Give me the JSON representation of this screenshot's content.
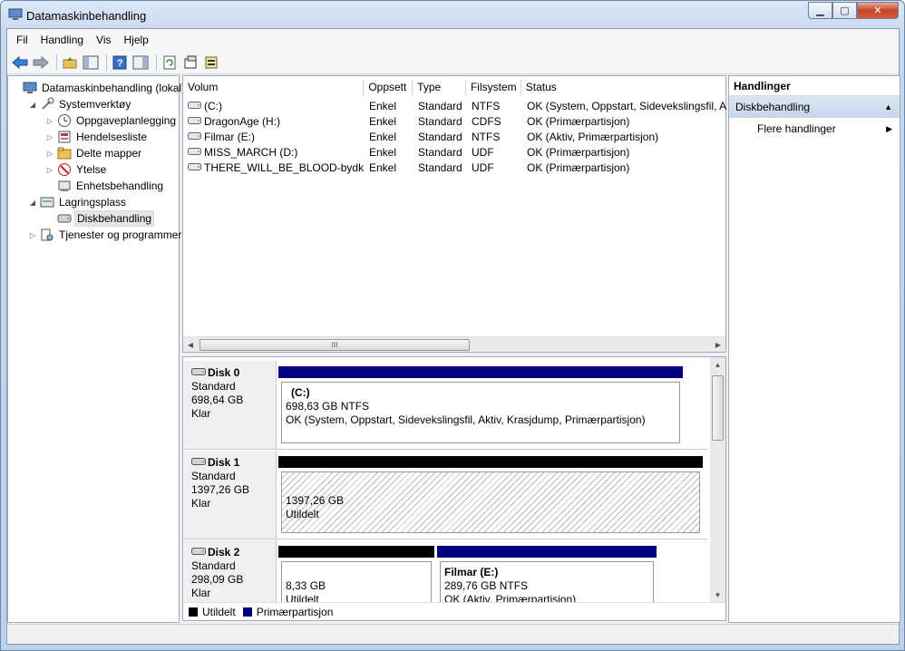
{
  "window": {
    "title": "Datamaskinbehandling",
    "buttons": {
      "minimize": "▁",
      "maximize": "▢",
      "close": "✕"
    }
  },
  "menubar": {
    "items": [
      "Fil",
      "Handling",
      "Vis",
      "Hjelp"
    ]
  },
  "toolbar": {
    "icons": [
      "back-arrow-icon",
      "forward-arrow-icon",
      "up-folder-icon",
      "show-hide-tree-icon",
      "help-icon",
      "show-hide-action-icon",
      "refresh-icon",
      "properties-icon",
      "export-icon"
    ]
  },
  "tree": {
    "items": [
      {
        "label": "Datamaskinbehandling (lokal)",
        "level": 0,
        "expander": "",
        "icon": "computer-icon"
      },
      {
        "label": "Systemverktøy",
        "level": 1,
        "expander": "◢",
        "icon": "tools-icon"
      },
      {
        "label": "Oppgaveplanlegging",
        "level": 2,
        "expander": "▷",
        "icon": "clock-icon"
      },
      {
        "label": "Hendelsesliste",
        "level": 2,
        "expander": "▷",
        "icon": "event-viewer-icon"
      },
      {
        "label": "Delte mapper",
        "level": 2,
        "expander": "▷",
        "icon": "shared-folder-icon"
      },
      {
        "label": "Ytelse",
        "level": 2,
        "expander": "▷",
        "icon": "performance-icon"
      },
      {
        "label": "Enhetsbehandling",
        "level": 2,
        "expander": "",
        "icon": "device-manager-icon"
      },
      {
        "label": "Lagringsplass",
        "level": 1,
        "expander": "◢",
        "icon": "storage-icon"
      },
      {
        "label": "Diskbehandling",
        "level": 2,
        "expander": "",
        "icon": "disk-management-icon",
        "selected": true
      },
      {
        "label": "Tjenester og programmer",
        "level": 1,
        "expander": "▷",
        "icon": "services-icon"
      }
    ]
  },
  "volume_list": {
    "columns": [
      "Volum",
      "Oppsett",
      "Type",
      "Filsystem",
      "Status"
    ],
    "rows": [
      {
        "volume": " (C:)",
        "layout": "Enkel",
        "type": "Standard",
        "fs": "NTFS",
        "status": "OK (System, Oppstart, Sidevekslingsfil, A"
      },
      {
        "volume": "DragonAge (H:)",
        "layout": "Enkel",
        "type": "Standard",
        "fs": "CDFS",
        "status": "OK (Primærpartisjon)"
      },
      {
        "volume": "Filmar (E:)",
        "layout": "Enkel",
        "type": "Standard",
        "fs": "NTFS",
        "status": "OK (Aktiv, Primærpartisjon)"
      },
      {
        "volume": "MISS_MARCH (D:)",
        "layout": "Enkel",
        "type": "Standard",
        "fs": "UDF",
        "status": "OK (Primærpartisjon)"
      },
      {
        "volume": "THERE_WILL_BE_BLOOD-bydk (J:)",
        "layout": "Enkel",
        "type": "Standard",
        "fs": "UDF",
        "status": "OK (Primærpartisjon)"
      }
    ],
    "scroll_thumb": "III"
  },
  "disks": [
    {
      "name": "Disk 0",
      "type": "Standard",
      "size": "698,64 GB",
      "state": "Klar",
      "partitions": [
        {
          "title": "(C:)",
          "size": "698,63 GB NTFS",
          "status": "OK (System, Oppstart, Sidevekslingsfil, Aktiv, Krasjdump, Primærpartisjon)",
          "kind": "primary"
        }
      ]
    },
    {
      "name": "Disk 1",
      "type": "Standard",
      "size": "1397,26 GB",
      "state": "Klar",
      "partitions": [
        {
          "title": "",
          "size": "1397,26 GB",
          "status": "Utildelt",
          "kind": "unallocated"
        }
      ]
    },
    {
      "name": "Disk 2",
      "type": "Standard",
      "size": "298,09 GB",
      "state": "Klar",
      "partitions": [
        {
          "title": "",
          "size": "8,33 GB",
          "status": "Utildelt",
          "kind": "unallocated"
        },
        {
          "title": "Filmar  (E:)",
          "size": "289,76 GB NTFS",
          "status": "OK (Aktiv, Primærpartisjon)",
          "kind": "primary"
        }
      ]
    }
  ],
  "legend": {
    "unallocated": "Utildelt",
    "primary": "Primærpartisjon",
    "colors": {
      "unallocated": "#000000",
      "primary": "#000080"
    }
  },
  "actions": {
    "header": "Handlinger",
    "section": "Diskbehandling",
    "items": [
      "Flere handlinger"
    ]
  }
}
